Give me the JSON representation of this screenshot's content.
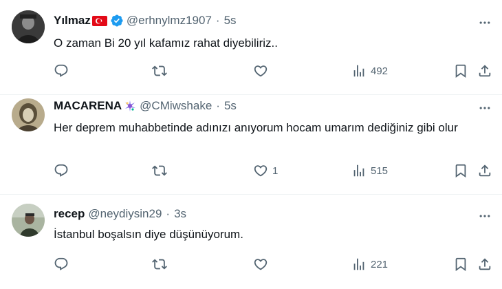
{
  "tweets": [
    {
      "name": "Yılmaz",
      "handle": "@erhnylmz1907",
      "dot": "·",
      "time": "5s",
      "text": "O zaman Bi 20 yıl kafamız rahat diyebiliriz..",
      "replies": "",
      "retweets": "",
      "likes": "",
      "views": "492"
    },
    {
      "name": "MACARENA",
      "handle": "@CMiwshake",
      "dot": "·",
      "time": "5s",
      "text": "Her deprem muhabbetinde adınızı anıyorum hocam umarım dediğiniz gibi olur",
      "replies": "",
      "retweets": "",
      "likes": "1",
      "views": "515"
    },
    {
      "name": "recep",
      "handle": "@neydiysin29",
      "dot": "·",
      "time": "3s",
      "text": "İstanbul boşalsın diye düşünüyorum.",
      "replies": "",
      "retweets": "",
      "likes": "",
      "views": "221"
    }
  ],
  "colors": {
    "muted": "#536471",
    "text": "#0f1419",
    "verified": "#1d9bf0",
    "divider": "#eff3f4"
  },
  "icons": [
    "reply-icon",
    "retweet-icon",
    "like-icon",
    "views-icon",
    "bookmark-icon",
    "share-icon",
    "more-icon",
    "verified-icon",
    "turkey-flag-icon",
    "pinata-emoji-icon"
  ]
}
